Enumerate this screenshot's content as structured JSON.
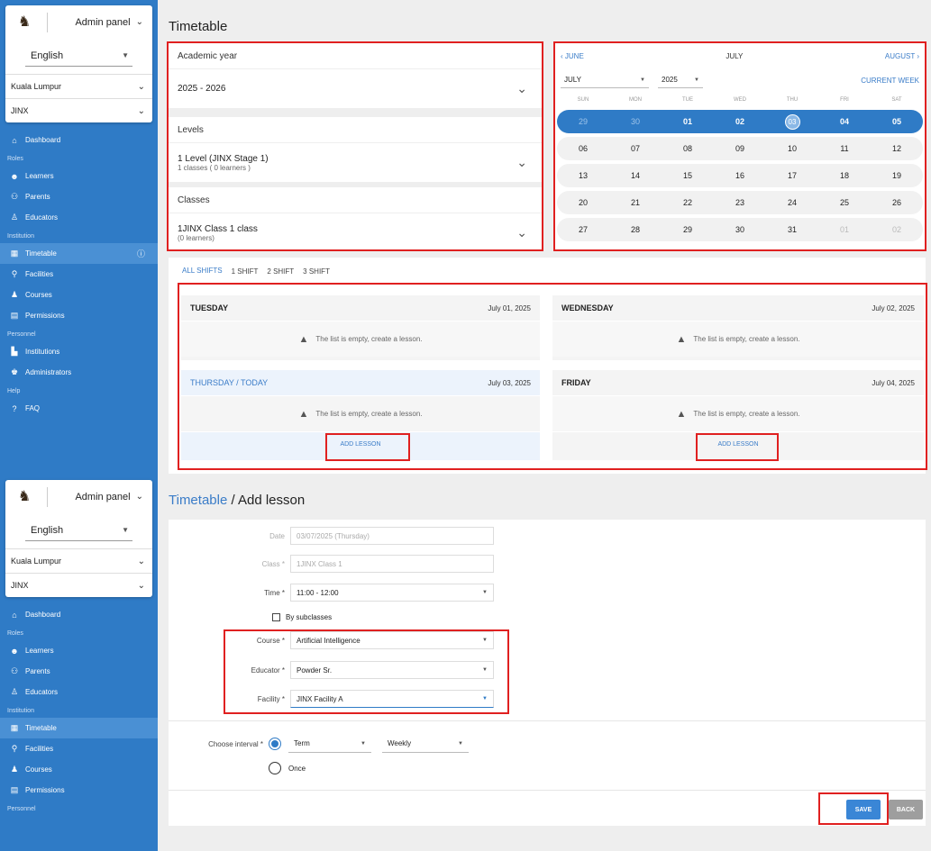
{
  "sidebar": {
    "admin_label": "Admin panel",
    "language": "English",
    "city": "Kuala Lumpur",
    "school": "JINX",
    "dashboard": "Dashboard",
    "section_roles": "Roles",
    "learners": "Learners",
    "parents": "Parents",
    "educators": "Educators",
    "section_institution": "Institution",
    "timetable": "Timetable",
    "facilities": "Facilities",
    "courses": "Courses",
    "permissions": "Permissions",
    "section_personnel": "Personnel",
    "institutions": "Institutions",
    "administrators": "Administrators",
    "section_help": "Help",
    "faq": "FAQ"
  },
  "timetable": {
    "title": "Timetable",
    "academic_year_label": "Academic year",
    "academic_year_value": "2025 - 2026",
    "levels_label": "Levels",
    "levels_value": "1 Level (JINX Stage 1)",
    "levels_sub": "1 classes ( 0 learners )",
    "classes_label": "Classes",
    "classes_value": "1JINX Class 1 class",
    "classes_sub": "(0 learners)"
  },
  "calendar": {
    "prev": "JUNE",
    "current": "JULY",
    "next": "AUGUST",
    "month_select": "JULY",
    "year_select": "2025",
    "current_week": "CURRENT WEEK",
    "dow": [
      "SUN",
      "MON",
      "TUE",
      "WED",
      "THU",
      "FRI",
      "SAT"
    ],
    "weeks": [
      [
        "29",
        "30",
        "01",
        "02",
        "03",
        "04",
        "05"
      ],
      [
        "06",
        "07",
        "08",
        "09",
        "10",
        "11",
        "12"
      ],
      [
        "13",
        "14",
        "15",
        "16",
        "17",
        "18",
        "19"
      ],
      [
        "20",
        "21",
        "22",
        "23",
        "24",
        "25",
        "26"
      ],
      [
        "27",
        "28",
        "29",
        "30",
        "31",
        "01",
        "02"
      ]
    ]
  },
  "shifts": {
    "tabs": [
      "ALL SHIFTS",
      "1 SHIFT",
      "2 SHIFT",
      "3 SHIFT"
    ],
    "empty_text": "The list is empty, create a lesson.",
    "add_lesson": "ADD LESSON",
    "days": [
      {
        "name": "TUESDAY",
        "date": "July 01, 2025"
      },
      {
        "name": "WEDNESDAY",
        "date": "July 02, 2025"
      },
      {
        "name": "THURSDAY / TODAY",
        "date": "July 03, 2025"
      },
      {
        "name": "FRIDAY",
        "date": "July 04, 2025"
      }
    ]
  },
  "add_lesson": {
    "crumb": "Timetable",
    "title": " / Add lesson",
    "date_label": "Date",
    "date_value": "03/07/2025 (Thursday)",
    "class_label": "Class *",
    "class_value": "1JINX Class 1",
    "time_label": "Time *",
    "time_value": "11:00 - 12:00",
    "by_subclasses": "By subclasses",
    "course_label": "Course *",
    "course_value": "Artificial Intelligence",
    "educator_label": "Educator *",
    "educator_value": "Powder Sr.",
    "facility_label": "Facility *",
    "facility_value": "JINX Facility A",
    "interval_label": "Choose interval *",
    "term": "Term",
    "weekly": "Weekly",
    "once": "Once",
    "save": "SAVE",
    "back": "BACK"
  }
}
